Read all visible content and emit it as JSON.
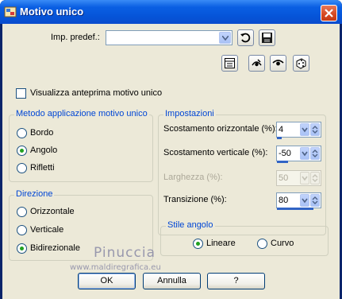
{
  "window": {
    "title": "Motivo unico"
  },
  "preset": {
    "label": "Imp. predef.:",
    "value": ""
  },
  "preview_checkbox": {
    "label": "Visualizza anteprima motivo unico",
    "checked": false
  },
  "method_group": {
    "title": "Metodo applicazione motivo unico",
    "options": [
      {
        "label": "Bordo",
        "selected": false
      },
      {
        "label": "Angolo",
        "selected": true
      },
      {
        "label": "Rifletti",
        "selected": false
      }
    ]
  },
  "direction_group": {
    "title": "Direzione",
    "options": [
      {
        "label": "Orizzontale",
        "selected": false
      },
      {
        "label": "Verticale",
        "selected": false
      },
      {
        "label": "Bidirezionale",
        "selected": true
      }
    ]
  },
  "settings_group": {
    "title": "Impostazioni",
    "fields": [
      {
        "label": "Scostamento orizzontale (%):",
        "value": "4",
        "enabled": true
      },
      {
        "label": "Scostamento verticale (%):",
        "value": "-50",
        "enabled": true
      },
      {
        "label": "Larghezza (%):",
        "value": "50",
        "enabled": false
      },
      {
        "label": "Transizione (%):",
        "value": "80",
        "enabled": true
      }
    ]
  },
  "corner_group": {
    "title": "Stile angolo",
    "options": [
      {
        "label": "Lineare",
        "selected": true
      },
      {
        "label": "Curvo",
        "selected": false
      }
    ]
  },
  "buttons": {
    "ok": "OK",
    "cancel": "Annulla",
    "help": "?"
  },
  "watermark": {
    "name": "Pinuccia",
    "url": "www.maldiregrafica.eu"
  },
  "icons": [
    "app-icon",
    "close-icon",
    "save-preset-icon",
    "load-preset-icon",
    "reset-icon",
    "eye-icon",
    "eye-closed-icon",
    "dice-icon"
  ],
  "colors": {
    "titlebar": "#0554d8",
    "group_title": "#0046d5",
    "radio_dot": "#21a121",
    "face": "#ece9d8"
  }
}
